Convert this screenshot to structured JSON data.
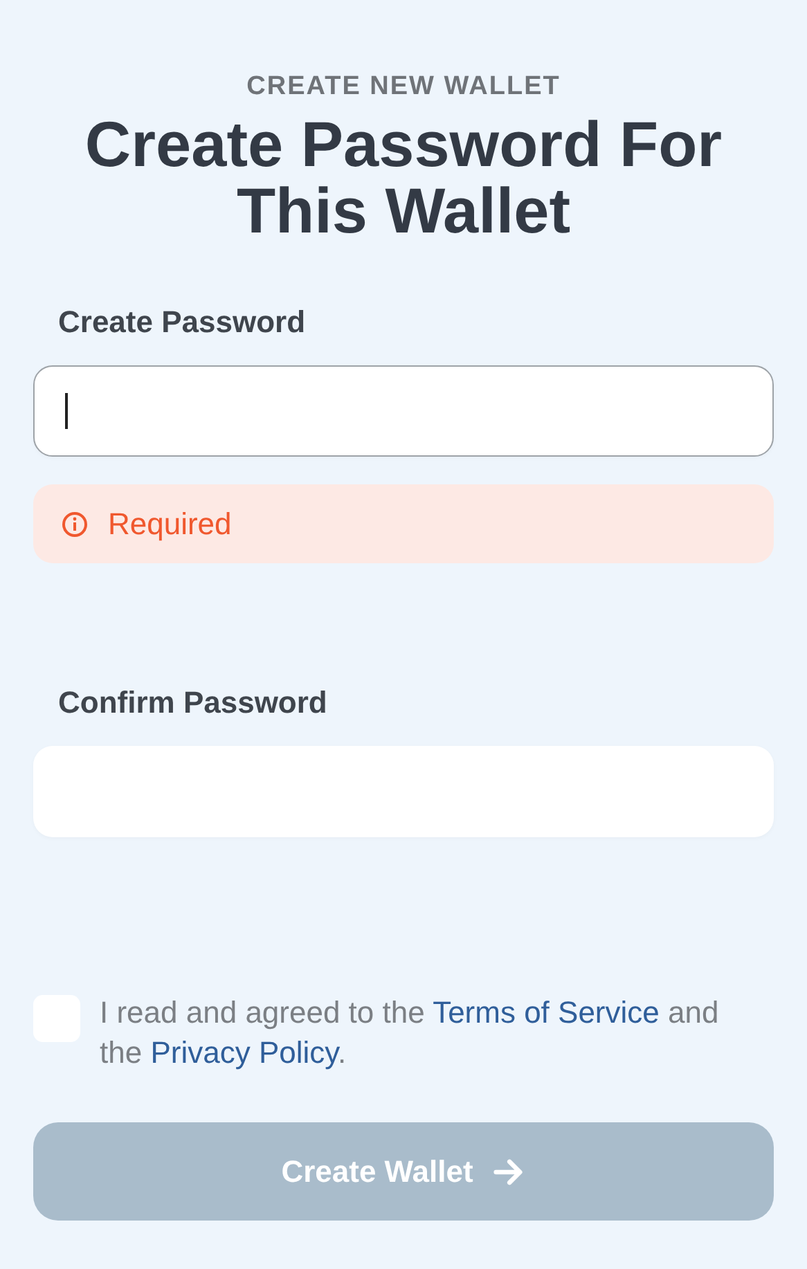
{
  "eyebrow": "CREATE NEW WALLET",
  "title": "Create Password For This Wallet",
  "fields": [
    {
      "label": "Create Password",
      "focused": true,
      "error": "Required"
    },
    {
      "label": "Confirm Password",
      "focused": false
    }
  ],
  "agreement": {
    "checked": false,
    "parts": [
      {
        "kind": "text",
        "text": "I read and agreed to the "
      },
      {
        "kind": "link",
        "text": "Terms of Service"
      },
      {
        "kind": "text",
        "text": " and the "
      },
      {
        "kind": "link",
        "text": "Privacy Policy"
      },
      {
        "kind": "text",
        "text": "."
      }
    ]
  },
  "submit": {
    "label": "Create Wallet",
    "disabled": true
  }
}
